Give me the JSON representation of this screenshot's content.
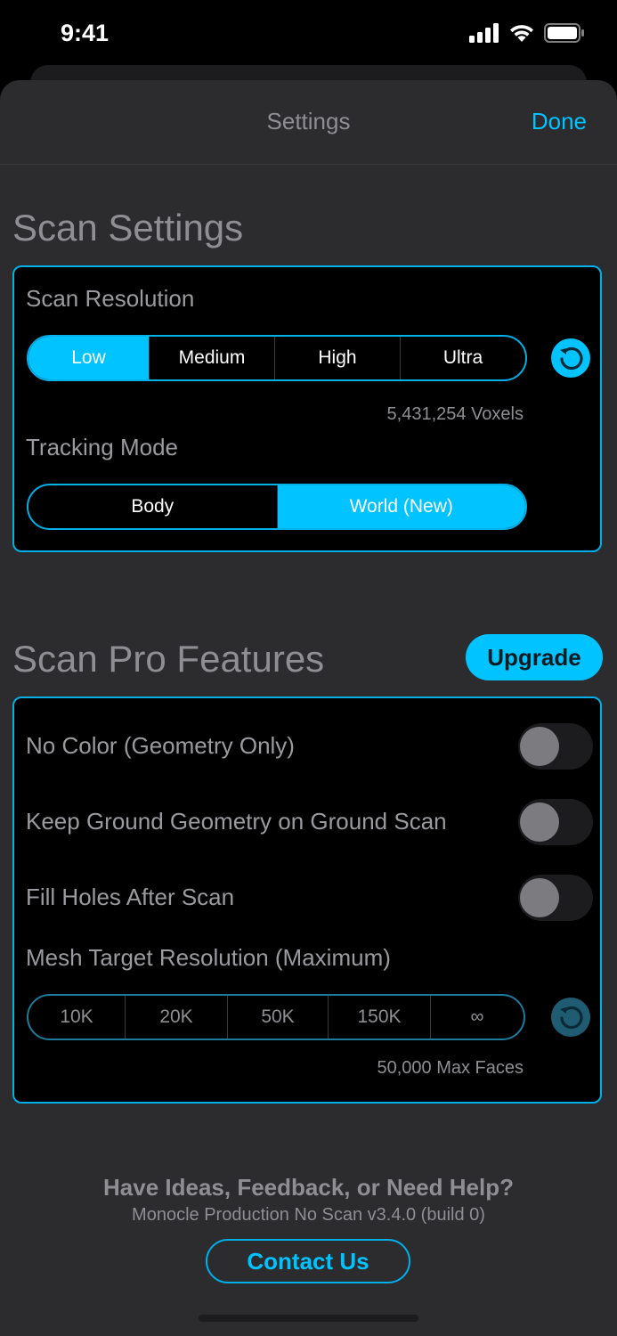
{
  "status_bar": {
    "time": "9:41"
  },
  "nav": {
    "title": "Settings",
    "done_label": "Done"
  },
  "scan_settings": {
    "section_title": "Scan Settings",
    "resolution_label": "Scan Resolution",
    "resolution_options": [
      "Low",
      "Medium",
      "High",
      "Ultra"
    ],
    "resolution_selected": "Low",
    "voxels_note": "5,431,254 Voxels",
    "tracking_label": "Tracking Mode",
    "tracking_options": [
      "Body",
      "World (New)"
    ],
    "tracking_selected": "World (New)"
  },
  "pro_features": {
    "section_title": "Scan Pro Features",
    "upgrade_label": "Upgrade",
    "toggles": [
      {
        "label": "No Color (Geometry Only)",
        "on": false
      },
      {
        "label": "Keep Ground Geometry on Ground Scan",
        "on": false
      },
      {
        "label": "Fill Holes After Scan",
        "on": false
      }
    ],
    "mesh_label": "Mesh Target Resolution (Maximum)",
    "mesh_options": [
      "10K",
      "20K",
      "50K",
      "150K",
      "∞"
    ],
    "faces_note": "50,000 Max Faces"
  },
  "footer": {
    "help_title": "Have Ideas, Feedback, or Need Help?",
    "version": "Monocle Production No Scan v3.4.0 (build 0)",
    "contact_label": "Contact Us"
  },
  "colors": {
    "accent": "#00c3ff",
    "background": "#2c2c2e",
    "card": "#000000"
  }
}
